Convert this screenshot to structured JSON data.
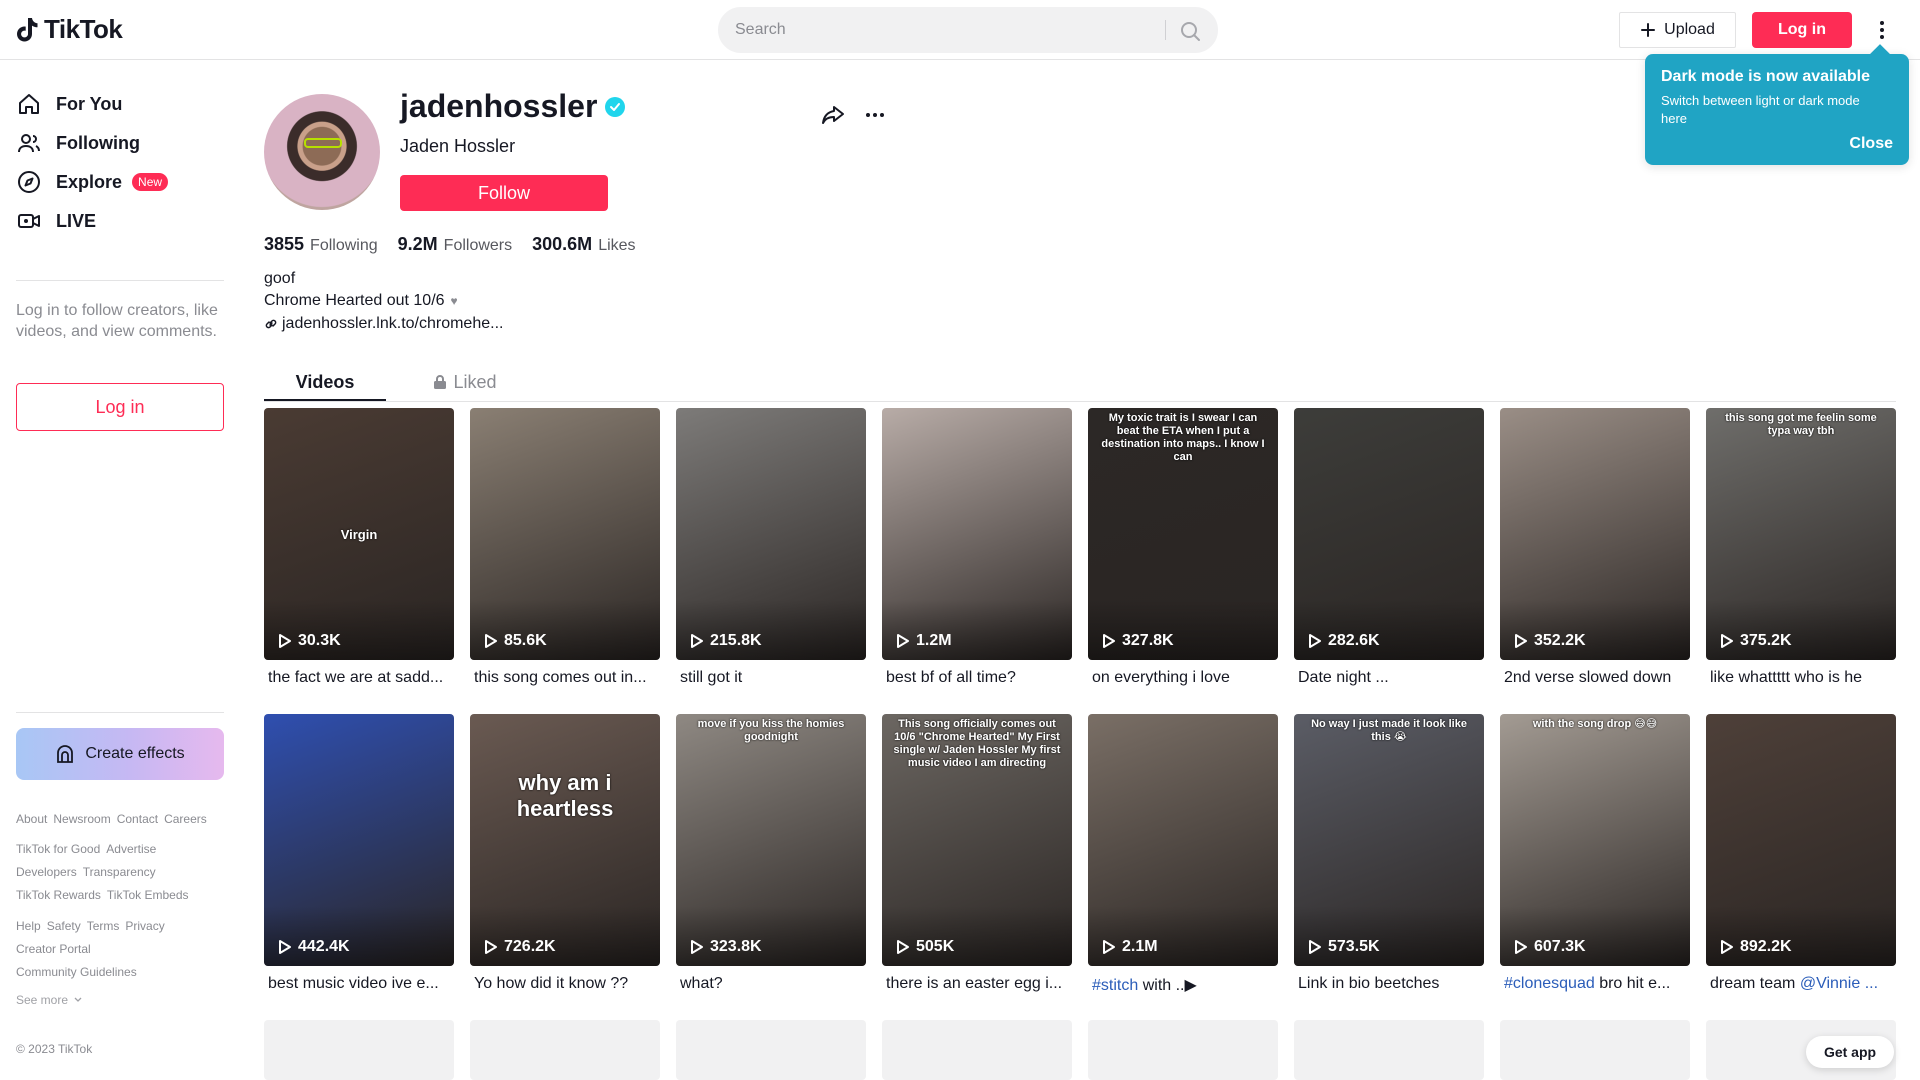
{
  "header": {
    "logo_text": "TikTok",
    "search_placeholder": "Search",
    "upload_label": "Upload",
    "login_label": "Log in"
  },
  "popup": {
    "title": "Dark mode is now available",
    "subtitle": "Switch between light or dark mode here",
    "close_label": "Close"
  },
  "sidebar": {
    "items": [
      {
        "label": "For You",
        "icon": "home-icon"
      },
      {
        "label": "Following",
        "icon": "users-icon"
      },
      {
        "label": "Explore",
        "icon": "compass-icon",
        "badge": "New"
      },
      {
        "label": "LIVE",
        "icon": "live-icon"
      }
    ],
    "prompt": "Log in to follow creators, like videos, and view comments.",
    "login_label": "Log in",
    "effects_label": "Create effects",
    "footer_rows": [
      [
        "About",
        "Newsroom",
        "Contact",
        "Careers"
      ],
      [
        "TikTok for Good",
        "Advertise"
      ],
      [
        "Developers",
        "Transparency"
      ],
      [
        "TikTok Rewards",
        "TikTok Embeds"
      ],
      [
        "Help",
        "Safety",
        "Terms",
        "Privacy"
      ],
      [
        "Creator Portal"
      ],
      [
        "Community Guidelines"
      ]
    ],
    "see_more": "See more",
    "copyright": "© 2023 TikTok"
  },
  "profile": {
    "username": "jadenhossler",
    "nickname": "Jaden Hossler",
    "follow_label": "Follow",
    "following_count": "3855",
    "following_label": "Following",
    "followers_count": "9.2M",
    "followers_label": "Followers",
    "likes_count": "300.6M",
    "likes_label": "Likes",
    "bio_line1": "goof",
    "bio_line2": "Chrome Hearted out 10/6",
    "bio_heart": "♥",
    "link": "jadenhossler.lnk.to/chromehe..."
  },
  "tabs": {
    "videos": "Videos",
    "liked": "Liked"
  },
  "videos": [
    {
      "views": "30.3K",
      "caption": "the fact we are at sadd...",
      "overlay": "Virgin",
      "bg": "#4a3b33"
    },
    {
      "views": "85.6K",
      "caption": "this song comes out in...",
      "overlay": "",
      "bg": "#8a7f73"
    },
    {
      "views": "215.8K",
      "caption": "still got it",
      "overlay": "",
      "bg": "#7d7b79"
    },
    {
      "views": "1.2M",
      "caption": "best bf of all time?",
      "overlay": "",
      "bg": "#b8aca7"
    },
    {
      "views": "327.8K",
      "caption": "on everything i love",
      "overlay": "My toxic trait is I swear I can beat the ETA when I put a destination into maps.. I know I can",
      "bg": "#2c2826"
    },
    {
      "views": "282.6K",
      "caption": "Date night ...",
      "overlay": "",
      "bg": "#3d3d3a"
    },
    {
      "views": "352.2K",
      "caption": "2nd verse slowed down",
      "overlay": "",
      "bg": "#9a8e86"
    },
    {
      "views": "375.2K",
      "caption": "like whattttt who is he",
      "overlay": "this song got me feelin some typa way tbh",
      "bg": "#6f6e6b"
    },
    {
      "views": "442.4K",
      "caption": "best music video ive e...",
      "overlay": "",
      "bg": "#2f4fb0"
    },
    {
      "views": "726.2K",
      "caption": "Yo how did it know ??",
      "overlay": "why am i heartless",
      "bg": "#6a5a52"
    },
    {
      "views": "323.8K",
      "caption": "what?",
      "overlay": "move if you kiss the homies goodnight",
      "bg": "#8f8983"
    },
    {
      "views": "505K",
      "caption": "there is an easter egg i...",
      "overlay": "This song officially comes out 10/6 \"Chrome Hearted\" My First single w/ Jaden Hossler My first music video I am directing",
      "bg": "#6c6762"
    },
    {
      "views": "2.1M",
      "caption_tag": "#stitch",
      "caption": "with ..▶",
      "overlay": "",
      "bg": "#7a6f66"
    },
    {
      "views": "573.5K",
      "caption": "Link in bio beetches",
      "overlay": "No way I just made it look like this 😭",
      "bg": "#5b5d66"
    },
    {
      "views": "607.3K",
      "caption_tag": "#clonesquad",
      "caption": "bro hit e...",
      "overlay": "with the song drop 😅😅",
      "bg": "#a39b93"
    },
    {
      "views": "892.2K",
      "caption": "dream team",
      "caption_mention": "@Vinnie ...",
      "overlay": "",
      "bg": "#4e4039"
    }
  ],
  "get_app_label": "Get app"
}
